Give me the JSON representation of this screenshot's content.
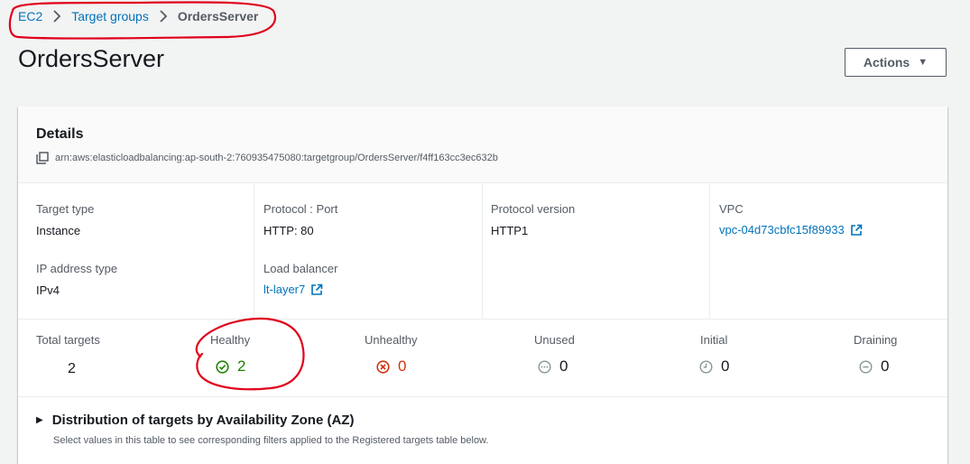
{
  "breadcrumb": {
    "items": [
      "EC2",
      "Target groups"
    ],
    "current": "OrdersServer"
  },
  "page": {
    "title": "OrdersServer",
    "actions_label": "Actions"
  },
  "details": {
    "title": "Details",
    "arn": "arn:aws:elasticloadbalancing:ap-south-2:760935475080:targetgroup/OrdersServer/f4ff163cc3ec632b",
    "target_type_label": "Target type",
    "target_type": "Instance",
    "ip_type_label": "IP address type",
    "ip_type": "IPv4",
    "protocol_port_label": "Protocol : Port",
    "protocol_port": "HTTP: 80",
    "load_balancer_label": "Load balancer",
    "load_balancer": "lt-layer7",
    "protocol_version_label": "Protocol version",
    "protocol_version": "HTTP1",
    "vpc_label": "VPC",
    "vpc": "vpc-04d73cbfc15f89933"
  },
  "stats": {
    "total_label": "Total targets",
    "total": "2",
    "healthy_label": "Healthy",
    "healthy": "2",
    "unhealthy_label": "Unhealthy",
    "unhealthy": "0",
    "unused_label": "Unused",
    "unused": "0",
    "initial_label": "Initial",
    "initial": "0",
    "draining_label": "Draining",
    "draining": "0"
  },
  "distribution": {
    "title": "Distribution of targets by Availability Zone (AZ)",
    "description": "Select values in this table to see corresponding filters applied to the Registered targets table below."
  },
  "colors": {
    "link": "#0073bb",
    "healthy": "#1d8102",
    "unhealthy": "#d13212",
    "neutral": "#879596",
    "annotation": "#e0001b"
  },
  "icons": {
    "separator": "chevron-right-icon",
    "actions": "caret-down-icon",
    "copy": "copy-icon",
    "external": "external-link-icon",
    "healthy": "status-check-icon",
    "unhealthy": "status-error-icon",
    "unused": "status-ellipsis-icon",
    "initial": "status-clock-icon",
    "draining": "status-minus-icon",
    "expand": "caret-right-icon"
  }
}
